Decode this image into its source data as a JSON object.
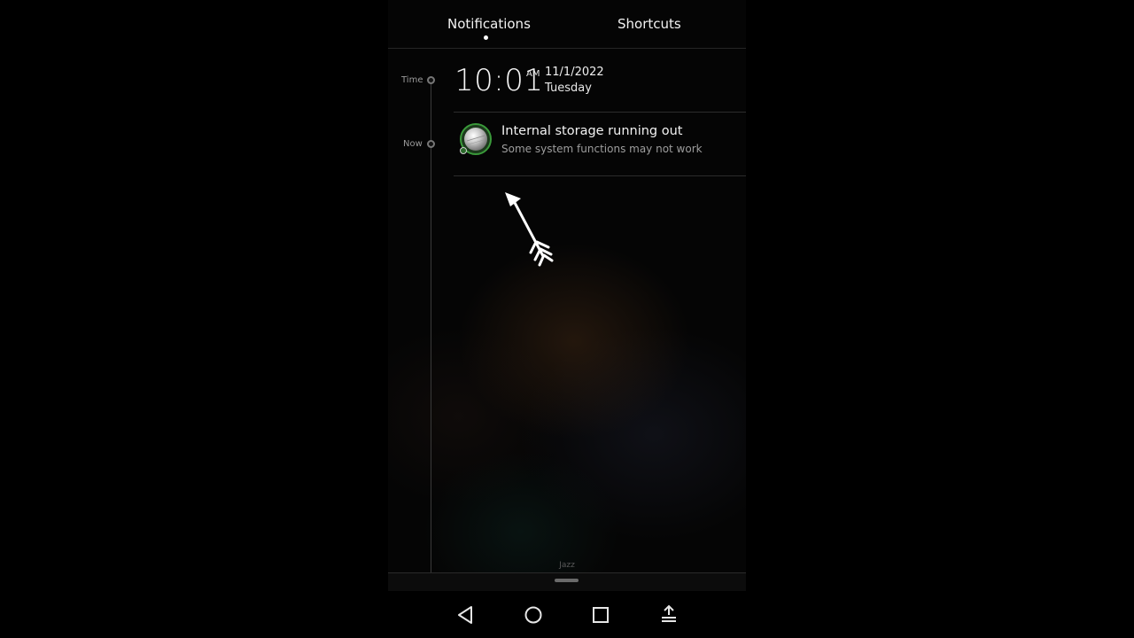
{
  "tabs": {
    "notifications_label": "Notifications",
    "shortcuts_label": "Shortcuts",
    "active": "Notifications"
  },
  "timeline": {
    "time_label": "Time",
    "now_label": "Now"
  },
  "clock": {
    "time": "10:01",
    "ampm": "AM",
    "date": "11/1/2022",
    "day": "Tuesday"
  },
  "notifications": [
    {
      "icon": "storage-disk-icon",
      "title": "Internal storage running out",
      "subtitle": "Some system functions may not work"
    }
  ],
  "footer": {
    "theme_label": "Jazz"
  },
  "nav_bar": {
    "icons": [
      "back-triangle-icon",
      "home-circle-icon",
      "recents-square-icon",
      "notification-panel-icon"
    ]
  },
  "colors": {
    "background": "#000000",
    "text_primary": "#f2f2f2",
    "text_secondary": "#9d9d9d",
    "icon_ring": "#3a9a3a"
  }
}
